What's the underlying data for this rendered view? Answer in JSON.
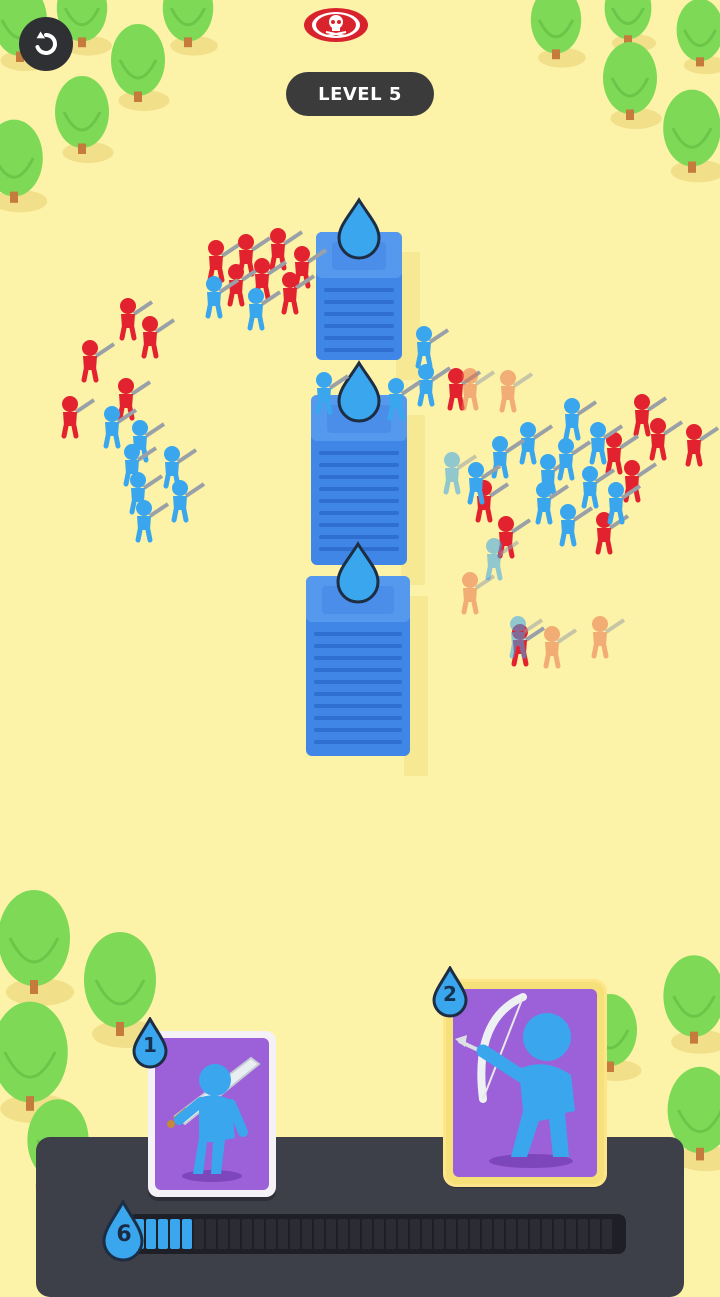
{
  "hud": {
    "back_icon": "undo-arrow-icon",
    "skull_icon": "skull-icon",
    "level_label": "LEVEL 5"
  },
  "colors": {
    "ground": "#fdf3a8",
    "blue_team": "#3aa6ee",
    "red_team": "#e3222f",
    "tower_blue": "#3f86e6",
    "card_purple": "#9c60d9",
    "panel": "#3d3f49",
    "tree": "#7ed957"
  },
  "cards": [
    {
      "name": "swordsman-card",
      "icon": "swordsman-icon",
      "cost": "1",
      "selected": false
    },
    {
      "name": "archer-card",
      "icon": "archer-icon",
      "cost": "2",
      "selected": true
    }
  ],
  "elixir": {
    "icon": "elixir-drop-icon",
    "count": "6",
    "fill_fraction": 0.12
  }
}
